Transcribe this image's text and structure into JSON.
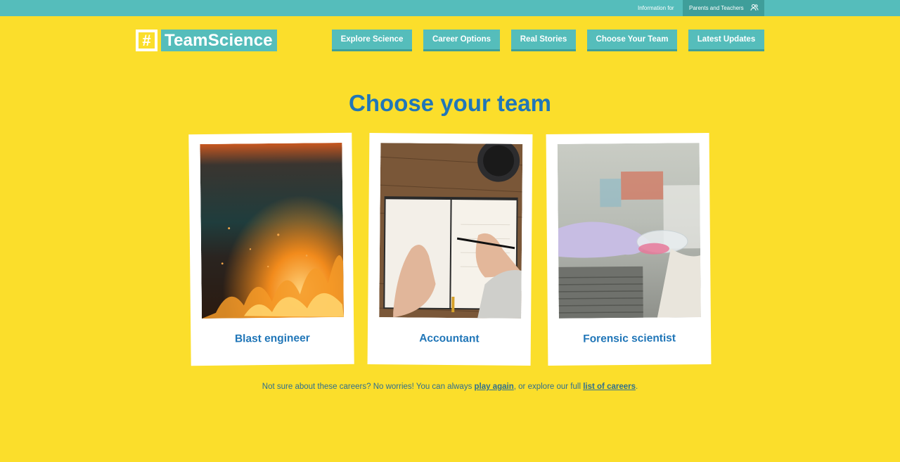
{
  "topbar": {
    "info_label": "Information for",
    "audience_link": "Parents and Teachers",
    "audience_icon": "people-icon"
  },
  "logo": {
    "hash": "#",
    "text": "TeamScience"
  },
  "nav": [
    {
      "label": "Explore Science"
    },
    {
      "label": "Career Options"
    },
    {
      "label": "Real Stories"
    },
    {
      "label": "Choose Your Team"
    },
    {
      "label": "Latest Updates"
    }
  ],
  "heading": "Choose your team",
  "cards": [
    {
      "label": "Blast engineer",
      "image": "fire-explosion-photo"
    },
    {
      "label": "Accountant",
      "image": "notebook-writing-photo"
    },
    {
      "label": "Forensic scientist",
      "image": "lab-petri-dish-photo"
    }
  ],
  "footnote": {
    "before": "Not sure about these careers? No worries! You can always ",
    "link1": "play again",
    "middle": ", or explore our full ",
    "link2": "list of careers",
    "after": "."
  },
  "colors": {
    "background": "#fbde2b",
    "teal": "#55bdbb",
    "teal_dark": "#3f9e9a",
    "heading_blue": "#2076b8"
  }
}
